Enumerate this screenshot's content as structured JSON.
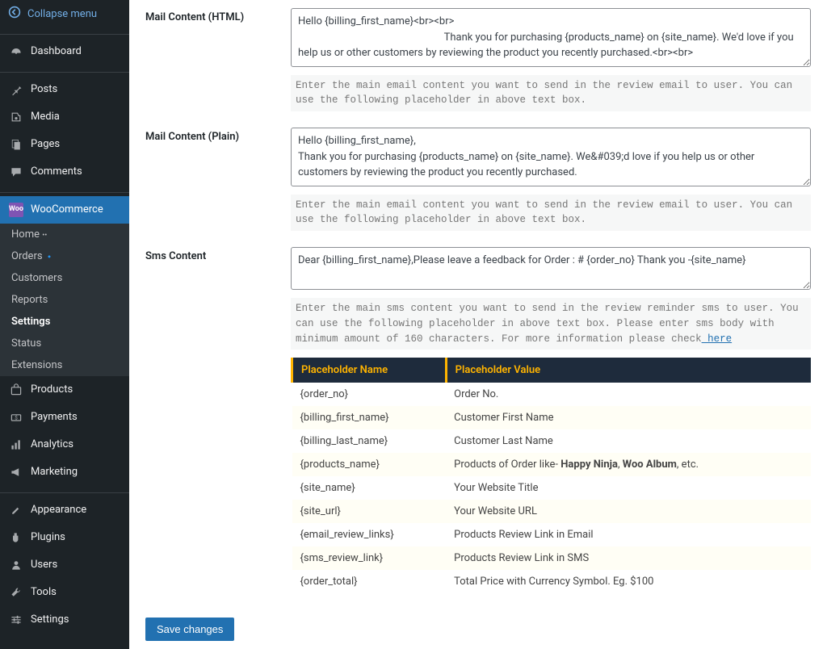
{
  "collapse_label": "Collapse menu",
  "menu": {
    "dashboard": "Dashboard",
    "posts": "Posts",
    "media": "Media",
    "pages": "Pages",
    "comments": "Comments",
    "woocommerce": "WooCommerce",
    "products": "Products",
    "payments": "Payments",
    "analytics": "Analytics",
    "marketing": "Marketing",
    "appearance": "Appearance",
    "plugins": "Plugins",
    "users": "Users",
    "tools": "Tools",
    "settings": "Settings"
  },
  "submenu": {
    "home": "Home",
    "orders": "Orders",
    "customers": "Customers",
    "reports": "Reports",
    "settings": "Settings",
    "status": "Status",
    "extensions": "Extensions"
  },
  "labels": {
    "mail_html": "Mail Content (HTML)",
    "mail_plain": "Mail Content (Plain)",
    "sms": "Sms Content"
  },
  "values": {
    "mail_html": "Hello {billing_first_name}<br><br>\n                                                        Thank you for purchasing {products_name} on {site_name}. We'd love if you help us or other customers by reviewing the product you recently purchased.<br><br>",
    "mail_plain": "Hello {billing_first_name},\nThank you for purchasing {products_name} on {site_name}. We&#039;d love if you help us or other customers by reviewing the product you recently purchased.",
    "sms": "Dear {billing_first_name},Please leave a feedback for Order : # {order_no} Thank you -{site_name}"
  },
  "desc": {
    "mail": "Enter the main email content you want to send in the review email to user. You can use the following placeholder in above text box.",
    "sms": "Enter the main sms content you want to send in the review reminder sms to user. You can use the following placeholder in above text box. Please enter sms body with minimum amount of 160 characters. For more information please check",
    "here": " here"
  },
  "table_headers": {
    "name": "Placeholder Name",
    "value": "Placeholder Value"
  },
  "placeholders": [
    {
      "name": "{order_no}",
      "value": "Order No."
    },
    {
      "name": "{billing_first_name}",
      "value": "Customer First Name"
    },
    {
      "name": "{billing_last_name}",
      "value": "Customer Last Name"
    },
    {
      "name": "{products_name}",
      "value": "Products of Order like- ",
      "bold": "Happy Ninja",
      "bold2": "Woo Album",
      "suffix": ", etc."
    },
    {
      "name": "{site_name}",
      "value": "Your Website Title"
    },
    {
      "name": "{site_url}",
      "value": "Your Website URL"
    },
    {
      "name": "{email_review_links}",
      "value": "Products Review Link in Email"
    },
    {
      "name": "{sms_review_link}",
      "value": "Products Review Link in SMS"
    },
    {
      "name": "{order_total}",
      "value": "Total Price with Currency Symbol. Eg. $100"
    }
  ],
  "save": "Save changes"
}
